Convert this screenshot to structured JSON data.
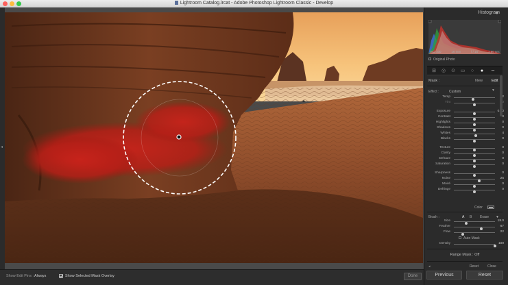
{
  "window": {
    "title": "Lightroom Catalog.lrcat - Adobe Photoshop Lightroom Classic - Develop"
  },
  "histogram": {
    "title": "Histogram",
    "iso": "ISO 100",
    "focal": "16 mm",
    "aperture": "f / 16",
    "shutter": "1.60 sec",
    "original_photo_label": "Original Photo"
  },
  "mask_header": {
    "mask_label": "Mask :",
    "new_label": "New",
    "edit_label": "Edit"
  },
  "effect": {
    "label": "Effect :",
    "value": "Custom"
  },
  "sliders": [
    {
      "label": "Temp",
      "value": "-2",
      "pos": 0.46,
      "muted": false
    },
    {
      "label": "Tint",
      "value": "0",
      "pos": 0.5,
      "muted": true
    },
    {
      "label": "Exposure",
      "value": "0.00",
      "pos": 0.5,
      "muted": false
    },
    {
      "label": "Contrast",
      "value": "0",
      "pos": 0.5,
      "muted": false
    },
    {
      "label": "Highlights",
      "value": "0",
      "pos": 0.5,
      "muted": false
    },
    {
      "label": "Shadows",
      "value": "0",
      "pos": 0.5,
      "muted": false
    },
    {
      "label": "Whites",
      "value": "4",
      "pos": 0.53,
      "muted": false
    },
    {
      "label": "Blacks",
      "value": "0",
      "pos": 0.5,
      "muted": false
    },
    {
      "label": "Texture",
      "value": "0",
      "pos": 0.5,
      "muted": false
    },
    {
      "label": "Clarity",
      "value": "0",
      "pos": 0.5,
      "muted": false
    },
    {
      "label": "Dehaze",
      "value": "0",
      "pos": 0.5,
      "muted": false
    },
    {
      "label": "Saturation",
      "value": "0",
      "pos": 0.5,
      "muted": false
    },
    {
      "label": "Sharpness",
      "value": "0",
      "pos": 0.5,
      "muted": false
    },
    {
      "label": "Noise",
      "value": "25",
      "pos": 0.62,
      "muted": false
    },
    {
      "label": "Moiré",
      "value": "0",
      "pos": 0.5,
      "muted": false
    },
    {
      "label": "Defringe",
      "value": "0",
      "pos": 0.5,
      "muted": false
    }
  ],
  "color_label": "Color",
  "brush": {
    "label": "Brush :",
    "a": "A",
    "b": "B",
    "erase": "Erase",
    "sliders": [
      {
        "label": "Size",
        "value": "18.0",
        "pos": 0.3
      },
      {
        "label": "Feather",
        "value": "67",
        "pos": 0.67
      },
      {
        "label": "Flow",
        "value": "22",
        "pos": 0.22
      }
    ],
    "auto_mask_label": "Auto Mask",
    "density": {
      "label": "Density",
      "value": "100",
      "pos": 1.0
    }
  },
  "range_mask": "Range Mask : Off",
  "panel_footer": {
    "reset_label": "Reset",
    "close_label": "Close"
  },
  "toolbar": {
    "show_edit_pins_label": "Show Edit Pins :",
    "show_edit_pins_value": "Always",
    "overlay_label": "Show Selected Mask Overlay",
    "done_label": "Done"
  },
  "bottom_buttons": {
    "previous": "Previous",
    "reset": "Reset"
  },
  "colors": {
    "mask_overlay": "#c0201a",
    "sky": "#f3b865",
    "panel_bg": "#2b2b2b"
  }
}
